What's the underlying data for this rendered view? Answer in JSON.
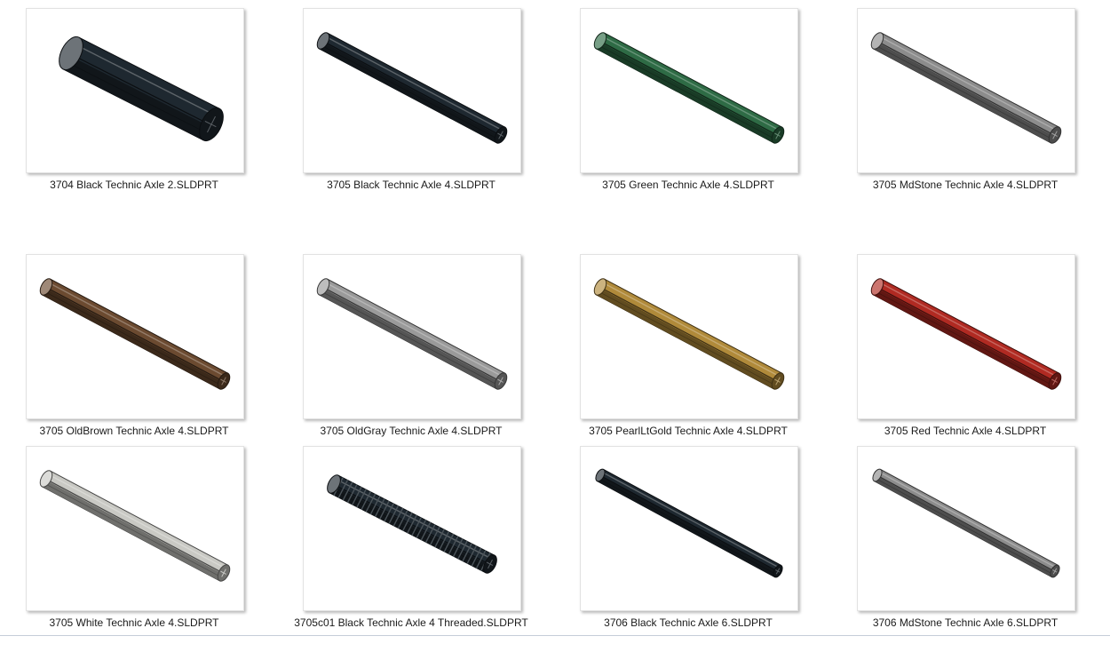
{
  "files": [
    {
      "name": "3704 Black Technic Axle 2.SLDPRT",
      "color": "#1e2830",
      "axle": "short",
      "icon": "axle-icon"
    },
    {
      "name": "3705 Black Technic Axle 4.SLDPRT",
      "color": "#1e2830",
      "axle": "long",
      "icon": "axle-icon"
    },
    {
      "name": "3705 Green Technic Axle 4.SLDPRT",
      "color": "#2e6b45",
      "axle": "long",
      "icon": "axle-icon"
    },
    {
      "name": "3705 MdStone Technic Axle 4.SLDPRT",
      "color": "#8c8c8c",
      "axle": "long",
      "icon": "axle-icon"
    },
    {
      "name": "3705 OldBrown Technic Axle 4.SLDPRT",
      "color": "#6b4a30",
      "axle": "long",
      "icon": "axle-icon"
    },
    {
      "name": "3705 OldGray Technic Axle 4.SLDPRT",
      "color": "#9a9a9a",
      "axle": "long",
      "icon": "axle-icon"
    },
    {
      "name": "3705 PearlLtGold Technic Axle 4.SLDPRT",
      "color": "#b08a3a",
      "axle": "long",
      "icon": "axle-icon"
    },
    {
      "name": "3705 Red Technic Axle 4.SLDPRT",
      "color": "#b02a22",
      "axle": "long",
      "icon": "axle-icon"
    },
    {
      "name": "3705 White Technic Axle 4.SLDPRT",
      "color": "#c9c9c4",
      "axle": "long",
      "icon": "axle-icon"
    },
    {
      "name": "3705c01 Black Technic Axle 4 Threaded.SLDPRT",
      "color": "#1e2830",
      "axle": "threaded",
      "icon": "threaded-axle-icon"
    },
    {
      "name": "3706 Black Technic Axle 6.SLDPRT",
      "color": "#1e2830",
      "axle": "longer",
      "icon": "axle-icon"
    },
    {
      "name": "3706 MdStone Technic Axle 6.SLDPRT",
      "color": "#8c8c8c",
      "axle": "longer",
      "icon": "axle-icon"
    }
  ]
}
